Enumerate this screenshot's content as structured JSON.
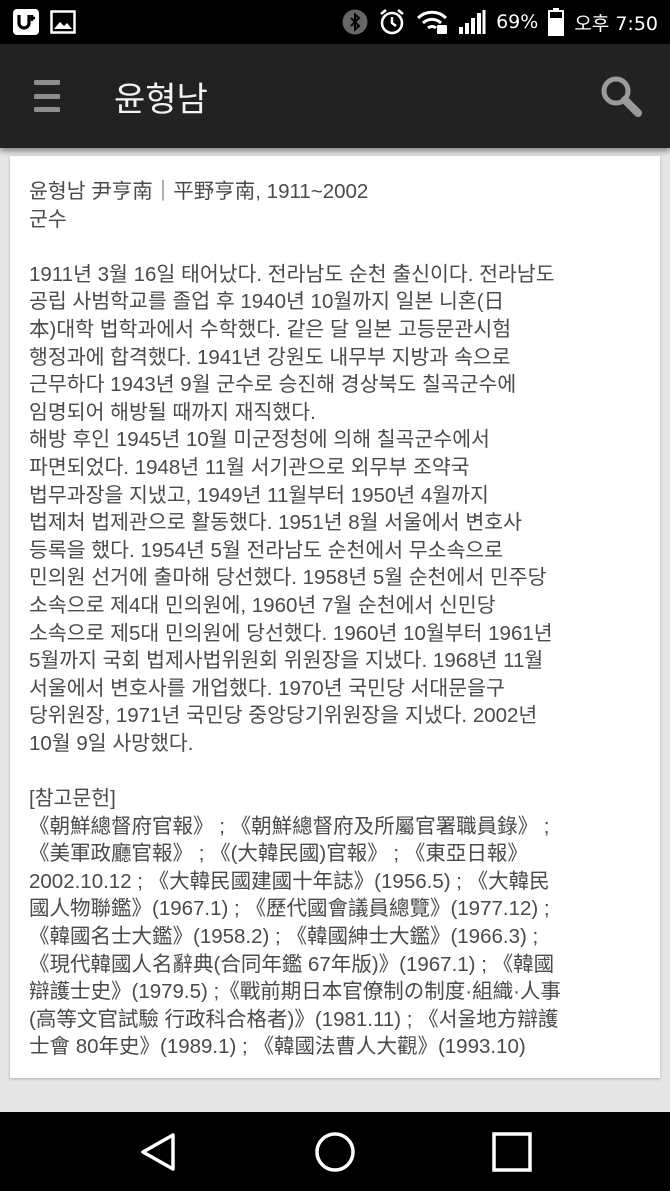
{
  "status_bar": {
    "battery": "69%",
    "time": "오후 7:50",
    "icons": [
      "uplus-icon",
      "gallery-icon",
      "bluetooth-icon",
      "alarm-icon",
      "wifi-icon",
      "signal-icon",
      "battery-icon"
    ]
  },
  "app_bar": {
    "title": "윤형남",
    "menu_icon": "menu-icon",
    "search_icon": "search-icon"
  },
  "article": {
    "header": "윤형남 尹亨南｜平野亨南, 1911~2002",
    "position": "군수",
    "body": "1911년 3월 16일 태어났다. 전라남도 순천 출신이다. 전라남도\n공립 사범학교를 졸업 후 1940년 10월까지 일본 니혼(日\n本)대학 법학과에서 수학했다. 같은 달 일본 고등문관시험\n행정과에 합격했다. 1941년 강원도 내무부 지방과 속으로\n근무하다 1943년 9월 군수로 승진해 경상북도 칠곡군수에\n임명되어 해방될 때까지 재직했다.\n해방 후인 1945년 10월 미군정청에 의해 칠곡군수에서\n파면되었다. 1948년 11월 서기관으로 외무부 조약국\n법무과장을 지냈고, 1949년 11월부터 1950년 4월까지\n법제처 법제관으로 활동했다. 1951년 8월 서울에서 변호사\n등록을 했다. 1954년 5월 전라남도 순천에서 무소속으로\n민의원 선거에 출마해 당선했다. 1958년 5월 순천에서 민주당\n소속으로 제4대 민의원에, 1960년 7월 순천에서 신민당\n소속으로 제5대 민의원에 당선했다. 1960년 10월부터 1961년\n5월까지 국회 법제사법위원회 위원장을 지냈다. 1968년 11월\n서울에서 변호사를 개업했다. 1970년 국민당 서대문을구\n당위원장, 1971년 국민당 중앙당기위원장을 지냈다. 2002년\n10월 9일 사망했다.",
    "references_title": "[참고문헌]",
    "references": "《朝鮮總督府官報》 ; 《朝鮮總督府及所屬官署職員錄》 ;\n《美軍政廳官報》 ; 《(大韓民國)官報》 ; 《東亞日報》\n2002.10.12 ; 《大韓民國建國十年誌》(1956.5) ; 《大韓民\n國人物聯鑑》(1967.1) ; 《歷代國會議員總覽》(1977.12) ;\n《韓國名士大鑑》(1958.2) ; 《韓國紳士大鑑》(1966.3) ;\n《現代韓國人名辭典(合同年鑑 67年版)》(1967.1) ; 《韓國\n辯護士史》(1979.5) ;《戰前期日本官僚制の制度·組織·人事\n(高等文官試驗 行政科合格者)》(1981.11) ; 《서울地方辯護\n士會 80年史》(1989.1) ; 《韓國法曹人大觀》(1993.10)"
  },
  "nav_bar": {
    "icons": [
      "back-icon",
      "home-icon",
      "recents-icon"
    ]
  }
}
